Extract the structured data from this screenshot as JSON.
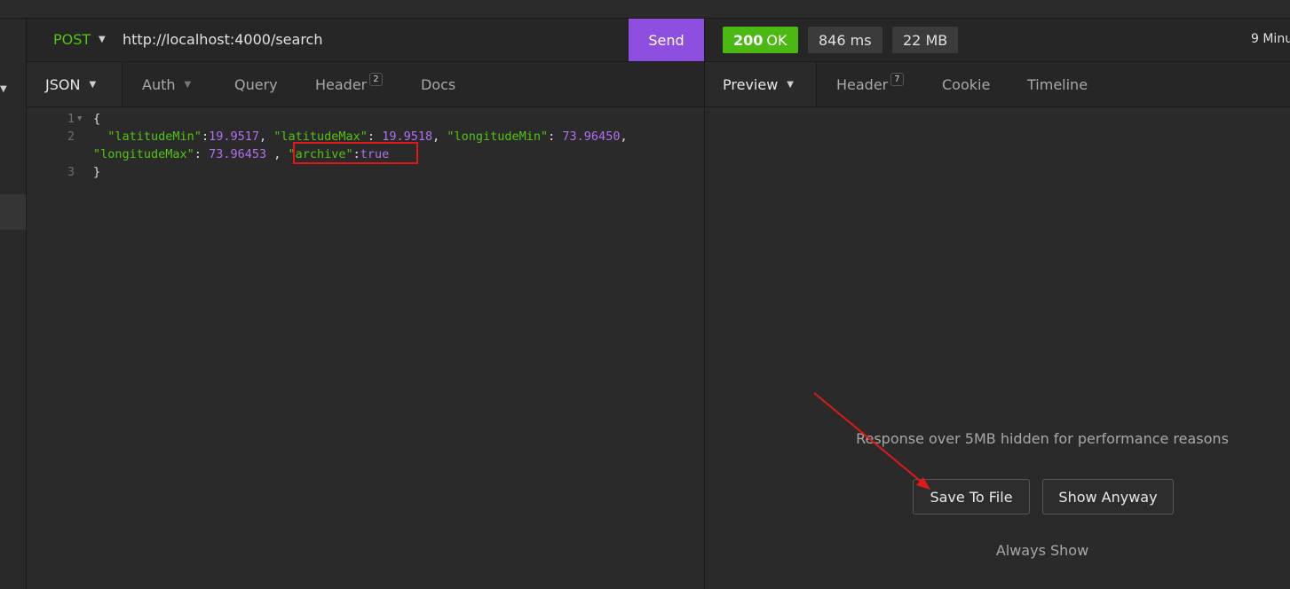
{
  "request": {
    "method": "POST",
    "url": "http://localhost:4000/search",
    "send_label": "Send",
    "tabs": [
      {
        "label": "JSON"
      },
      {
        "label": "Auth"
      },
      {
        "label": "Query"
      },
      {
        "label": "Header",
        "badge": "2"
      },
      {
        "label": "Docs"
      }
    ],
    "body_lines": [
      {
        "n": "1",
        "text": "{"
      },
      {
        "n": "2",
        "key1": "\"latitudeMin\"",
        "val1": "19.9517",
        "key2": "\"latitudeMax\"",
        "val2": "19.9518",
        "key3": "\"longitudeMin\"",
        "val3": "73.96450"
      },
      {
        "key4": "\"longitudeMax\"",
        "val4": "73.96453",
        "key5": "\"archive\"",
        "val5": "true"
      },
      {
        "n": "3",
        "text": "}"
      }
    ]
  },
  "response": {
    "status_code": "200",
    "status_text": "OK",
    "time": "846 ms",
    "size": "22 MB",
    "age": "9 Minu",
    "tabs": [
      {
        "label": "Preview"
      },
      {
        "label": "Header",
        "badge": "7"
      },
      {
        "label": "Cookie"
      },
      {
        "label": "Timeline"
      }
    ],
    "hidden_message": "Response over 5MB hidden for performance reasons",
    "save_label": "Save To File",
    "show_label": "Show Anyway",
    "always_label": "Always Show"
  },
  "colors": {
    "accent": "#8e4fe0",
    "method": "#54c214",
    "status_ok": "#4cb814",
    "json_key": "#54c214",
    "json_value": "#b26ff0",
    "annotation": "#e01818"
  }
}
